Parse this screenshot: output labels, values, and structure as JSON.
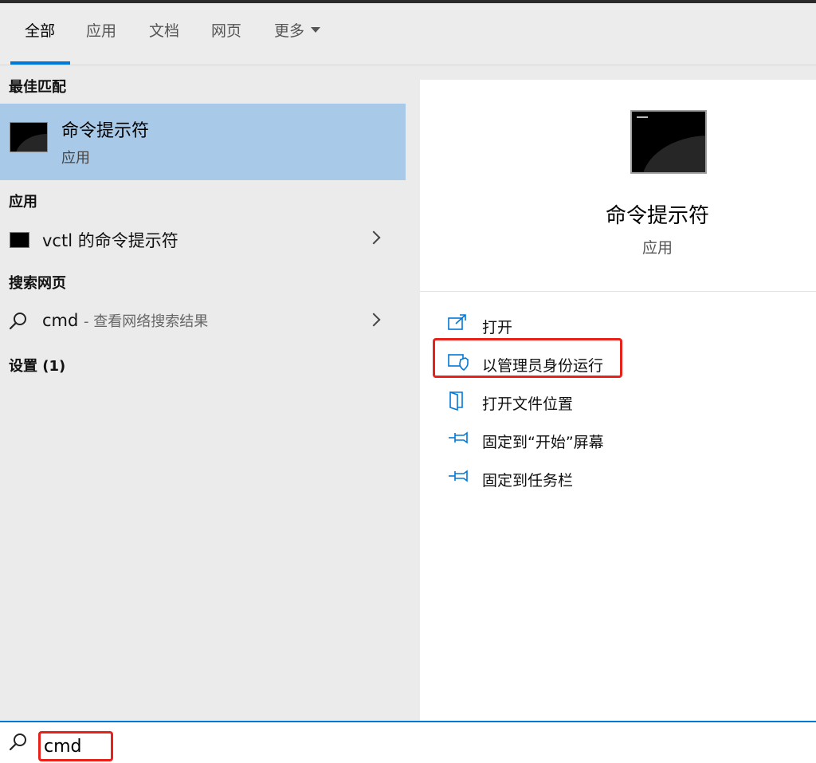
{
  "tabs": [
    {
      "label": "全部",
      "active": true
    },
    {
      "label": "应用",
      "active": false
    },
    {
      "label": "文档",
      "active": false
    },
    {
      "label": "网页",
      "active": false
    },
    {
      "label": "更多",
      "active": false
    }
  ],
  "left": {
    "best_match_title": "最佳匹配",
    "best_match": {
      "name": "命令提示符",
      "type": "应用",
      "icon": "cmd-terminal-icon"
    },
    "apps_title": "应用",
    "apps": [
      {
        "name": "vctl 的命令提示符",
        "icon": "terminal-icon"
      }
    ],
    "web_title": "搜索网页",
    "web": [
      {
        "query": "cmd",
        "hint": "- 查看网络搜索结果",
        "icon": "search-icon"
      }
    ],
    "settings_title": "设置 (1)"
  },
  "detail": {
    "title": "命令提示符",
    "subtitle": "应用",
    "actions": [
      {
        "label": "打开",
        "icon": "open-icon"
      },
      {
        "label": "以管理员身份运行",
        "icon": "shield-icon"
      },
      {
        "label": "打开文件位置",
        "icon": "file-location-icon"
      },
      {
        "label": "固定到“开始”屏幕",
        "icon": "pin-icon"
      },
      {
        "label": "固定到任务栏",
        "icon": "pin-icon"
      }
    ]
  },
  "search": {
    "value": "cmd"
  },
  "colors": {
    "accent": "#0078d7",
    "selection": "#a8cae8",
    "highlight": "#e8221b"
  }
}
